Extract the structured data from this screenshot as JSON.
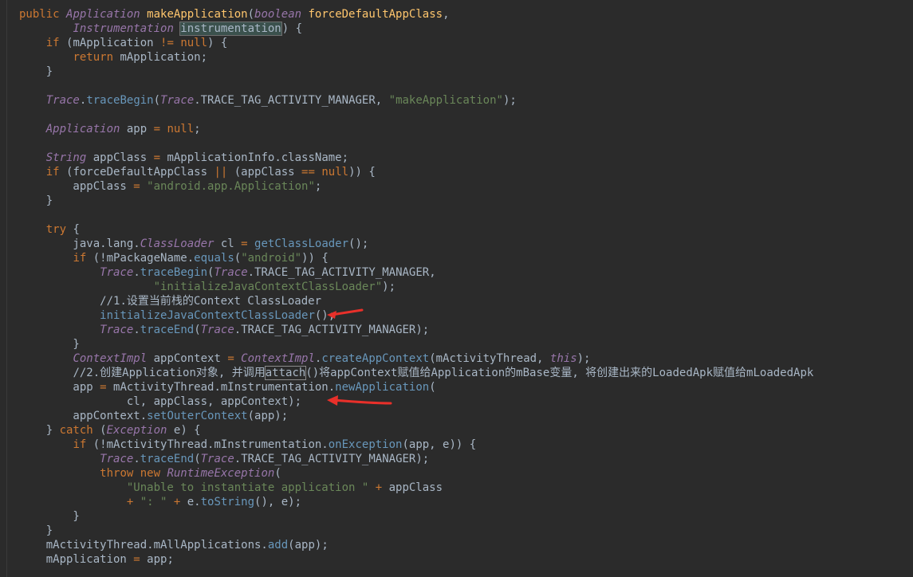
{
  "lines": [
    {
      "id": "l1",
      "tokens": [
        [
          "kw",
          "public "
        ],
        [
          "type",
          "Application "
        ],
        [
          "fn",
          "makeApplication"
        ],
        [
          "plain",
          "("
        ],
        [
          "type",
          "boolean "
        ],
        [
          "fn",
          "forceDefaultAppClass"
        ],
        [
          "plain",
          ","
        ]
      ]
    },
    {
      "id": "l2",
      "tokens": [
        [
          "plain",
          "        "
        ],
        [
          "type",
          "Instrumentation "
        ],
        [
          "hl",
          "instrumentation"
        ],
        [
          "caret",
          ""
        ],
        [
          "plain",
          ") {"
        ]
      ]
    },
    {
      "id": "l3",
      "tokens": [
        [
          "plain",
          "    "
        ],
        [
          "kw",
          "if "
        ],
        [
          "plain",
          "(mApplication "
        ],
        [
          "kw",
          "!= "
        ],
        [
          "kw",
          "null"
        ],
        [
          "plain",
          ") {"
        ]
      ]
    },
    {
      "id": "l4",
      "tokens": [
        [
          "plain",
          "        "
        ],
        [
          "kw",
          "return "
        ],
        [
          "plain",
          "mApplication;"
        ]
      ]
    },
    {
      "id": "l5",
      "tokens": [
        [
          "plain",
          "    }"
        ]
      ]
    },
    {
      "id": "l6",
      "tokens": []
    },
    {
      "id": "l7",
      "tokens": [
        [
          "plain",
          "    "
        ],
        [
          "type",
          "Trace"
        ],
        [
          "plain",
          "."
        ],
        [
          "meth",
          "traceBegin"
        ],
        [
          "plain",
          "("
        ],
        [
          "type",
          "Trace"
        ],
        [
          "plain",
          ".TRACE_TAG_ACTIVITY_MANAGER, "
        ],
        [
          "str",
          "\"makeApplication\""
        ],
        [
          "plain",
          ");"
        ]
      ]
    },
    {
      "id": "l8",
      "tokens": []
    },
    {
      "id": "l9",
      "tokens": [
        [
          "plain",
          "    "
        ],
        [
          "type",
          "Application "
        ],
        [
          "plain",
          "app "
        ],
        [
          "kw",
          "= "
        ],
        [
          "kw",
          "null"
        ],
        [
          "plain",
          ";"
        ]
      ]
    },
    {
      "id": "l10",
      "tokens": []
    },
    {
      "id": "l11",
      "tokens": [
        [
          "plain",
          "    "
        ],
        [
          "type",
          "String "
        ],
        [
          "plain",
          "appClass "
        ],
        [
          "kw",
          "= "
        ],
        [
          "plain",
          "mApplicationInfo.className;"
        ]
      ]
    },
    {
      "id": "l12",
      "tokens": [
        [
          "plain",
          "    "
        ],
        [
          "kw",
          "if "
        ],
        [
          "plain",
          "(forceDefaultAppClass "
        ],
        [
          "kw",
          "|| "
        ],
        [
          "plain",
          "(appClass "
        ],
        [
          "kw",
          "== "
        ],
        [
          "kw",
          "null"
        ],
        [
          "plain",
          ")) {"
        ]
      ]
    },
    {
      "id": "l13",
      "tokens": [
        [
          "plain",
          "        appClass "
        ],
        [
          "kw",
          "= "
        ],
        [
          "str",
          "\"android.app.Application\""
        ],
        [
          "plain",
          ";"
        ]
      ]
    },
    {
      "id": "l14",
      "tokens": [
        [
          "plain",
          "    }"
        ]
      ]
    },
    {
      "id": "l15",
      "tokens": []
    },
    {
      "id": "l16",
      "tokens": [
        [
          "plain",
          "    "
        ],
        [
          "kw",
          "try "
        ],
        [
          "plain",
          "{"
        ]
      ]
    },
    {
      "id": "l17",
      "tokens": [
        [
          "plain",
          "        java.lang."
        ],
        [
          "type",
          "ClassLoader "
        ],
        [
          "plain",
          "cl "
        ],
        [
          "kw",
          "= "
        ],
        [
          "meth",
          "getClassLoader"
        ],
        [
          "plain",
          "();"
        ]
      ]
    },
    {
      "id": "l18",
      "tokens": [
        [
          "plain",
          "        "
        ],
        [
          "kw",
          "if "
        ],
        [
          "plain",
          "(!mPackageName."
        ],
        [
          "meth",
          "equals"
        ],
        [
          "plain",
          "("
        ],
        [
          "str",
          "\"android\""
        ],
        [
          "plain",
          ")) {"
        ]
      ]
    },
    {
      "id": "l19",
      "tokens": [
        [
          "plain",
          "            "
        ],
        [
          "type",
          "Trace"
        ],
        [
          "plain",
          "."
        ],
        [
          "meth",
          "traceBegin"
        ],
        [
          "plain",
          "("
        ],
        [
          "type",
          "Trace"
        ],
        [
          "plain",
          ".TRACE_TAG_ACTIVITY_MANAGER,"
        ]
      ]
    },
    {
      "id": "l20",
      "tokens": [
        [
          "plain",
          "                    "
        ],
        [
          "str",
          "\"initializeJavaContextClassLoader\""
        ],
        [
          "plain",
          ");"
        ]
      ]
    },
    {
      "id": "l21",
      "tokens": [
        [
          "plain",
          "            "
        ],
        [
          "cm",
          "//1.设置当前栈的Context ClassLoader"
        ]
      ]
    },
    {
      "id": "l22",
      "tokens": [
        [
          "plain",
          "            "
        ],
        [
          "meth",
          "initializeJavaContextClassLoader"
        ],
        [
          "plain",
          "();"
        ]
      ]
    },
    {
      "id": "l23",
      "tokens": [
        [
          "plain",
          "            "
        ],
        [
          "type",
          "Trace"
        ],
        [
          "plain",
          "."
        ],
        [
          "meth",
          "traceEnd"
        ],
        [
          "plain",
          "("
        ],
        [
          "type",
          "Trace"
        ],
        [
          "plain",
          ".TRACE_TAG_ACTIVITY_MANAGER);"
        ]
      ]
    },
    {
      "id": "l24",
      "tokens": [
        [
          "plain",
          "        }"
        ]
      ]
    },
    {
      "id": "l25",
      "tokens": [
        [
          "plain",
          "        "
        ],
        [
          "type",
          "ContextImpl "
        ],
        [
          "plain",
          "appContext "
        ],
        [
          "kw",
          "= "
        ],
        [
          "type",
          "ContextImpl"
        ],
        [
          "plain",
          "."
        ],
        [
          "meth",
          "createAppContext"
        ],
        [
          "plain",
          "(mActivityThread, "
        ],
        [
          "type",
          "this"
        ],
        [
          "plain",
          ");"
        ]
      ]
    },
    {
      "id": "l26",
      "tokens": [
        [
          "plain",
          "        "
        ],
        [
          "cm",
          "//2.创建Application对象, 并调用"
        ],
        [
          "box",
          "attach"
        ],
        [
          "cm",
          "()将appContext赋值给Application的mBase变量, 将创建出来的LoadedApk赋值给mLoadedApk"
        ]
      ]
    },
    {
      "id": "l27",
      "tokens": [
        [
          "plain",
          "        app "
        ],
        [
          "kw",
          "= "
        ],
        [
          "plain",
          "mActivityThread.mInstrumentation."
        ],
        [
          "meth",
          "newApplication"
        ],
        [
          "plain",
          "("
        ]
      ]
    },
    {
      "id": "l28",
      "tokens": [
        [
          "plain",
          "                cl, appClass, appContext);"
        ]
      ]
    },
    {
      "id": "l29",
      "tokens": [
        [
          "plain",
          "        appContext."
        ],
        [
          "meth",
          "setOuterContext"
        ],
        [
          "plain",
          "(app);"
        ]
      ]
    },
    {
      "id": "l30",
      "tokens": [
        [
          "plain",
          "    } "
        ],
        [
          "kw",
          "catch "
        ],
        [
          "plain",
          "("
        ],
        [
          "type",
          "Exception "
        ],
        [
          "plain",
          "e) {"
        ]
      ]
    },
    {
      "id": "l31",
      "tokens": [
        [
          "plain",
          "        "
        ],
        [
          "kw",
          "if "
        ],
        [
          "plain",
          "(!mActivityThread.mInstrumentation."
        ],
        [
          "meth",
          "onException"
        ],
        [
          "plain",
          "(app, e)) {"
        ]
      ]
    },
    {
      "id": "l32",
      "tokens": [
        [
          "plain",
          "            "
        ],
        [
          "type",
          "Trace"
        ],
        [
          "plain",
          "."
        ],
        [
          "meth",
          "traceEnd"
        ],
        [
          "plain",
          "("
        ],
        [
          "type",
          "Trace"
        ],
        [
          "plain",
          ".TRACE_TAG_ACTIVITY_MANAGER);"
        ]
      ]
    },
    {
      "id": "l33",
      "tokens": [
        [
          "plain",
          "            "
        ],
        [
          "kw",
          "throw new "
        ],
        [
          "type",
          "RuntimeException"
        ],
        [
          "plain",
          "("
        ]
      ]
    },
    {
      "id": "l34",
      "tokens": [
        [
          "plain",
          "                "
        ],
        [
          "str",
          "\"Unable to instantiate application \" "
        ],
        [
          "kw",
          "+ "
        ],
        [
          "plain",
          "appClass"
        ]
      ]
    },
    {
      "id": "l35",
      "tokens": [
        [
          "plain",
          "                "
        ],
        [
          "kw",
          "+ "
        ],
        [
          "str",
          "\": \" "
        ],
        [
          "kw",
          "+ "
        ],
        [
          "plain",
          "e."
        ],
        [
          "meth",
          "toString"
        ],
        [
          "plain",
          "(), e);"
        ]
      ]
    },
    {
      "id": "l36",
      "tokens": [
        [
          "plain",
          "        }"
        ]
      ]
    },
    {
      "id": "l37",
      "tokens": [
        [
          "plain",
          "    }"
        ]
      ]
    },
    {
      "id": "l38",
      "tokens": [
        [
          "plain",
          "    mActivityThread.mAllApplications."
        ],
        [
          "meth",
          "add"
        ],
        [
          "plain",
          "(app);"
        ]
      ]
    },
    {
      "id": "l39",
      "tokens": [
        [
          "plain",
          "    mApplication "
        ],
        [
          "kw",
          "= "
        ],
        [
          "plain",
          "app;"
        ]
      ]
    }
  ],
  "annotations": {
    "arrow_color": "#e8302a",
    "arrow_icon": "red-arrow-icon"
  }
}
